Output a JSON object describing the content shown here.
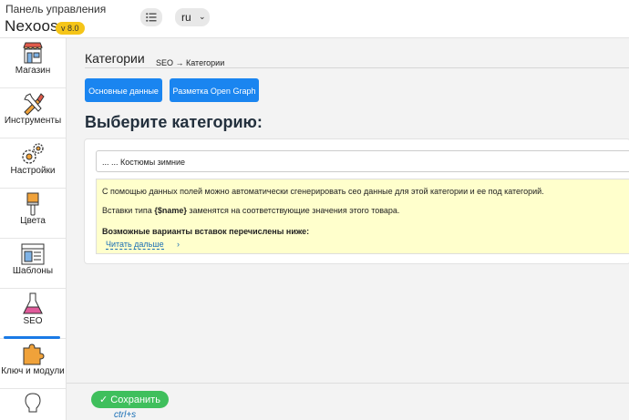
{
  "header": {
    "subtitle": "Панель управления",
    "app_name": "Nexoos",
    "version": "v 8.0",
    "language": "ru"
  },
  "sidebar": {
    "items": [
      {
        "label": "Магазин",
        "icon": "store-icon"
      },
      {
        "label": "Инструменты",
        "icon": "tools-icon"
      },
      {
        "label": "Настройки",
        "icon": "gears-icon"
      },
      {
        "label": "Цвета",
        "icon": "brush-icon"
      },
      {
        "label": "Шаблоны",
        "icon": "templates-icon"
      },
      {
        "label": "SEO",
        "icon": "flask-icon",
        "active": true
      },
      {
        "label": "Ключ и модули",
        "icon": "puzzle-icon"
      },
      {
        "label": "",
        "icon": "lightbulb-icon"
      }
    ]
  },
  "main": {
    "title": "Категории",
    "breadcrumb": "SEO → Категории",
    "tabs": [
      {
        "label": "Основные данные"
      },
      {
        "label": "Разметка Open Graph"
      }
    ],
    "heading": "Выберите категорию:",
    "category_value": "... ... Костюмы зимние",
    "info_line1": "С помощью данных полей можно автоматически сгенерировать сео данные для этой категории и ее под категорий.",
    "info_line2_pre": "Вставки типа ",
    "info_line2_token": "{$name}",
    "info_line2_post": " заменятся на соответствующие значения этого товара.",
    "info_line3": "Возможные варианты вставок перечислены ниже:",
    "read_more": "Читать дальше",
    "read_more_chevron": "›"
  },
  "footer": {
    "save_label": "✓ Сохранить",
    "shortcut": "ctrl+s"
  },
  "colors": {
    "primary": "#1a85f0",
    "save": "#3fbf5c",
    "version_badge": "#f5c518",
    "info_bg": "#ffffcc"
  }
}
